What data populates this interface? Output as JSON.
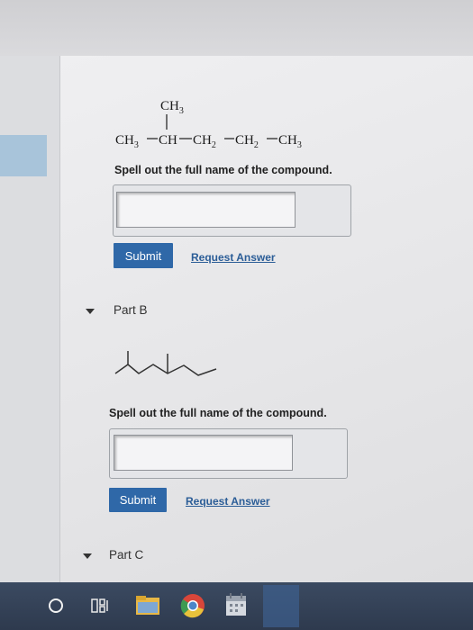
{
  "part_a": {
    "formula": {
      "branch": "CH",
      "branch_sub": "3",
      "c1": "CH",
      "c1_sub": "3",
      "c2": "CH",
      "c3": "CH",
      "c3_sub": "2",
      "c4": "CH",
      "c4_sub": "2",
      "c5": "CH",
      "c5_sub": "3"
    },
    "prompt": "Spell out the full name of the compound.",
    "answer_value": "",
    "submit_label": "Submit",
    "request_label": "Request Answer"
  },
  "part_b": {
    "label": "Part B",
    "prompt": "Spell out the full name of the compound.",
    "answer_value": "",
    "submit_label": "Submit",
    "request_label": "Request Answer"
  },
  "part_c": {
    "label": "Part C"
  },
  "colors": {
    "accent": "#2f68a8",
    "link": "#2b5d97",
    "taskbar": "#34425a"
  }
}
